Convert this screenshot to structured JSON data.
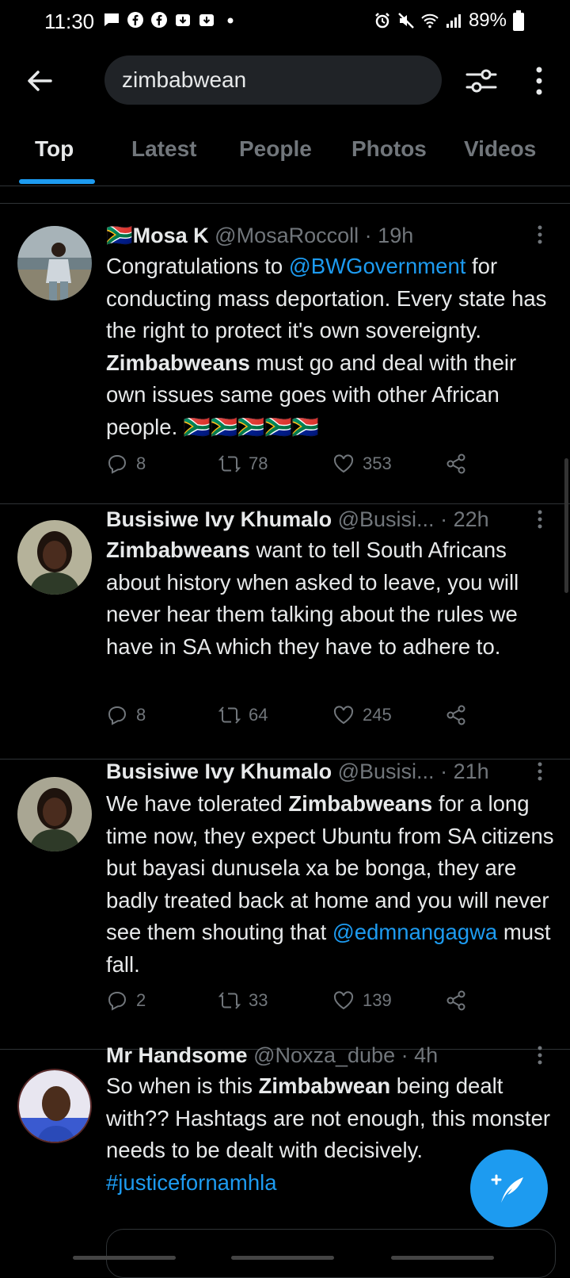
{
  "status_bar": {
    "time": "11:30",
    "battery": "89%",
    "left_icons": [
      "chat-icon",
      "facebook-icon",
      "facebook-icon",
      "download-icon",
      "download-icon",
      "dot-icon"
    ],
    "right_icons": [
      "alarm-icon",
      "mute-icon",
      "wifi-icon",
      "signal-icon",
      "battery-icon"
    ]
  },
  "header": {
    "search_value": "zimbabwean"
  },
  "tabs": [
    {
      "label": "Top",
      "active": true
    },
    {
      "label": "Latest",
      "active": false
    },
    {
      "label": "People",
      "active": false
    },
    {
      "label": "Photos",
      "active": false
    },
    {
      "label": "Videos",
      "active": false
    }
  ],
  "tweets": [
    {
      "name": "Mosa K",
      "handle": "@MosaRoccoll",
      "time": "19h",
      "text_parts": [
        "Congratulations to ",
        "@BWGovernment",
        " for conducting mass deportation. Every state has the right to protect it's own sovereignty. ",
        "Zimbabweans",
        " must go and deal with their own issues same goes with other African people. ",
        "🇿🇦🇿🇦🇿🇦🇿🇦🇿🇦"
      ],
      "replies": "8",
      "retweets": "78",
      "likes": "353"
    },
    {
      "name": "Busisiwe Ivy Khumalo",
      "handle": "@Busisi...",
      "time": "22h",
      "text_parts": [
        "Zimbabweans",
        " want to tell South Africans about history when asked to leave, you will never hear them talking about the rules we have in SA which they have to adhere to."
      ],
      "replies": "8",
      "retweets": "64",
      "likes": "245"
    },
    {
      "name": "Busisiwe Ivy Khumalo",
      "handle": "@Busisi...",
      "time": "21h",
      "text_parts": [
        "We have tolerated ",
        "Zimbabweans",
        " for a long time now, they expect Ubuntu from SA citizens but bayasi dunusela xa be bonga, they are badly treated back at home and you will never see them shouting that ",
        "@edmnangagwa",
        " must fall."
      ],
      "replies": "2",
      "retweets": "33",
      "likes": "139"
    },
    {
      "name": "Mr Handsome",
      "handle": "@Noxza_dube",
      "time": "4h",
      "text_parts": [
        "So when is this ",
        "Zimbabwean",
        " being dealt with?? Hashtags are not enough, this monster needs to be dealt with decisively. ",
        "#justicefornamhla"
      ]
    }
  ],
  "colors": {
    "accent": "#1d9bf0",
    "background": "#000000",
    "muted": "#71767b",
    "text": "#e7e9ea"
  }
}
